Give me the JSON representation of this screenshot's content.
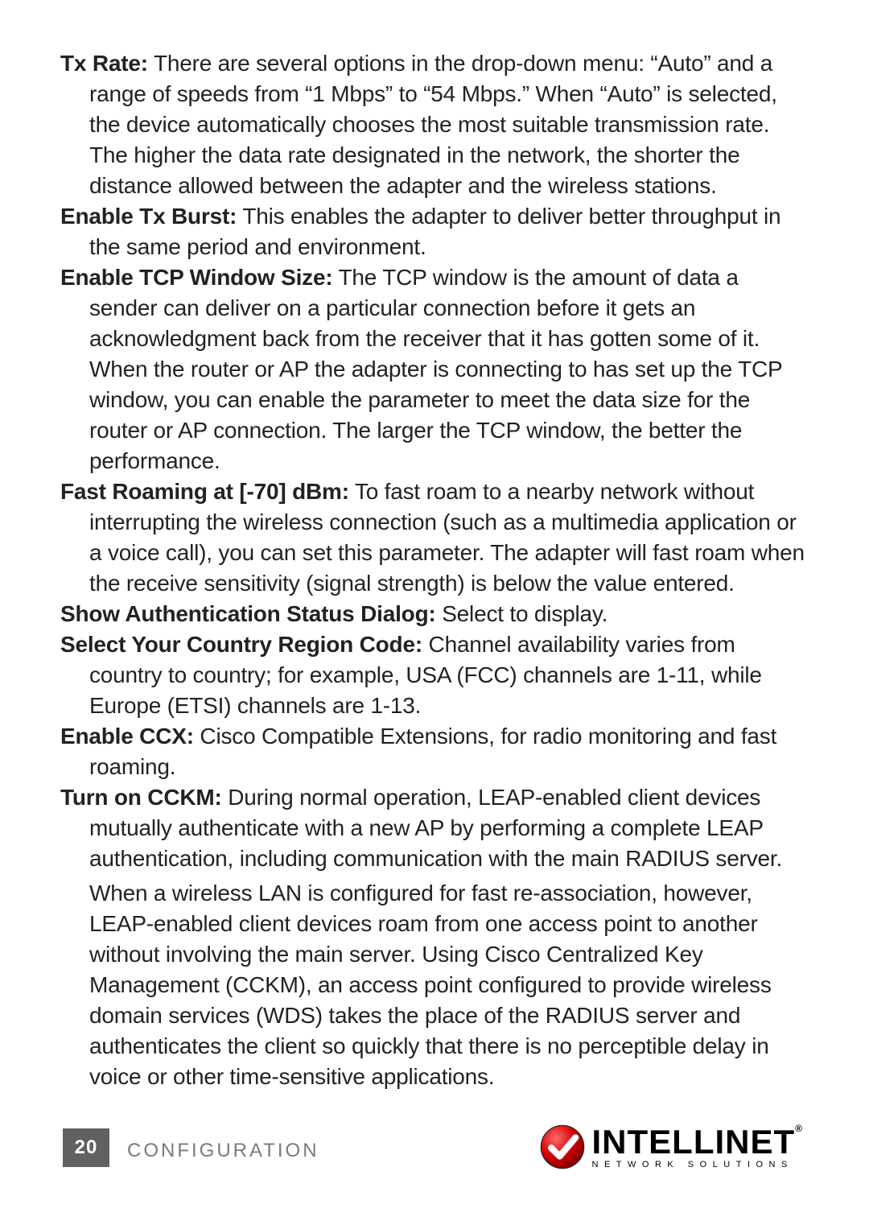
{
  "items": [
    {
      "label": "Tx Rate:",
      "text": "There are several options in the drop-down menu: “Auto” and a range of speeds from “1 Mbps” to “54 Mbps.” When “Auto” is selected, the device automatically chooses the most suitable transmission rate. The higher the data rate designated in the network, the shorter the distance allowed between the adapter and the wireless stations."
    },
    {
      "label": "Enable Tx Burst:",
      "text": "This enables the adapter to deliver better throughput in the same period and environment."
    },
    {
      "label": "Enable TCP Window Size:",
      "text": "The TCP window is the amount of data a sender can deliver on a particular connection before it gets an acknowledgment back from the receiver that it has gotten some of it. When the router or AP the adapter is connecting to has set up the TCP window, you can enable the parameter to meet the data size for the router or AP connection. The larger the TCP window, the better the performance."
    },
    {
      "label": "Fast Roaming at [-70] dBm:",
      "text": "To fast roam to a nearby network without interrupting the wireless connection (such as a multimedia application or a voice call), you can set this parameter. The adapter will fast roam when the receive sensitivity (signal strength) is below the value entered."
    },
    {
      "label": "Show Authentication Status Dialog:",
      "text": "Select to display."
    },
    {
      "label": "Select Your Country Region Code:",
      "text": "Channel availability varies from country to country; for example, USA (FCC) channels are 1-11, while Europe (ETSI) channels are 1-13."
    },
    {
      "label": "Enable CCX:",
      "text": "Cisco Compatible Extensions, for radio monitoring and fast roaming."
    },
    {
      "label": "Turn on CCKM:",
      "text": "During normal operation, LEAP-enabled client devices mutually authenticate with a new AP by performing a complete LEAP authentication, including communication with the main RADIUS server.",
      "text2": "When a wireless LAN is configured for fast re-association, however, LEAP-enabled client devices roam from one access point to another without involving the main server. Using Cisco Centralized Key Management (CCKM), an access point configured to provide wireless domain services (WDS) takes the place of the RADIUS server and authenticates the client so quickly that there is no perceptible delay in voice or other time-sensitive applications."
    }
  ],
  "footer": {
    "page_number": "20",
    "section": "CONFIGURATION",
    "brand_main": "INTELLINET",
    "brand_sub": "NETWORK SOLUTIONS"
  }
}
